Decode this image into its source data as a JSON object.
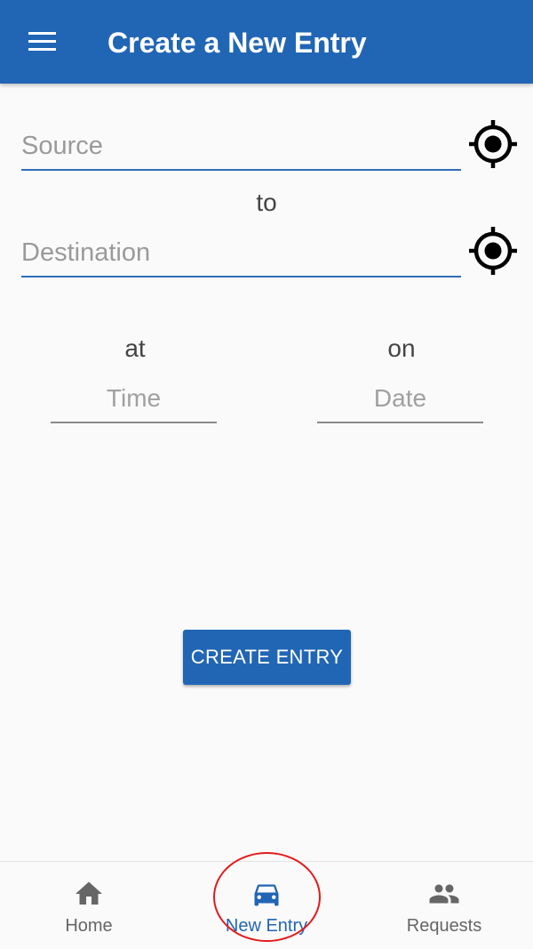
{
  "header": {
    "title": "Create a New Entry",
    "menu_icon": "hamburger-menu-icon"
  },
  "form": {
    "source": {
      "placeholder": "Source",
      "value": ""
    },
    "to_label": "to",
    "destination": {
      "placeholder": "Destination",
      "value": ""
    },
    "at_label": "at",
    "time": {
      "placeholder": "Time",
      "value": ""
    },
    "on_label": "on",
    "date": {
      "placeholder": "Date",
      "value": ""
    },
    "locate_icon": "crosshair-location-icon",
    "submit_label": "CREATE ENTRY"
  },
  "bottom_nav": {
    "items": [
      {
        "label": "Home",
        "icon": "home-icon",
        "active": false
      },
      {
        "label": "New Entry",
        "icon": "car-icon",
        "active": true
      },
      {
        "label": "Requests",
        "icon": "people-icon",
        "active": false
      }
    ]
  },
  "colors": {
    "primary": "#2166b4",
    "inactive": "#666666",
    "highlight_circle": "#e31b1b"
  }
}
